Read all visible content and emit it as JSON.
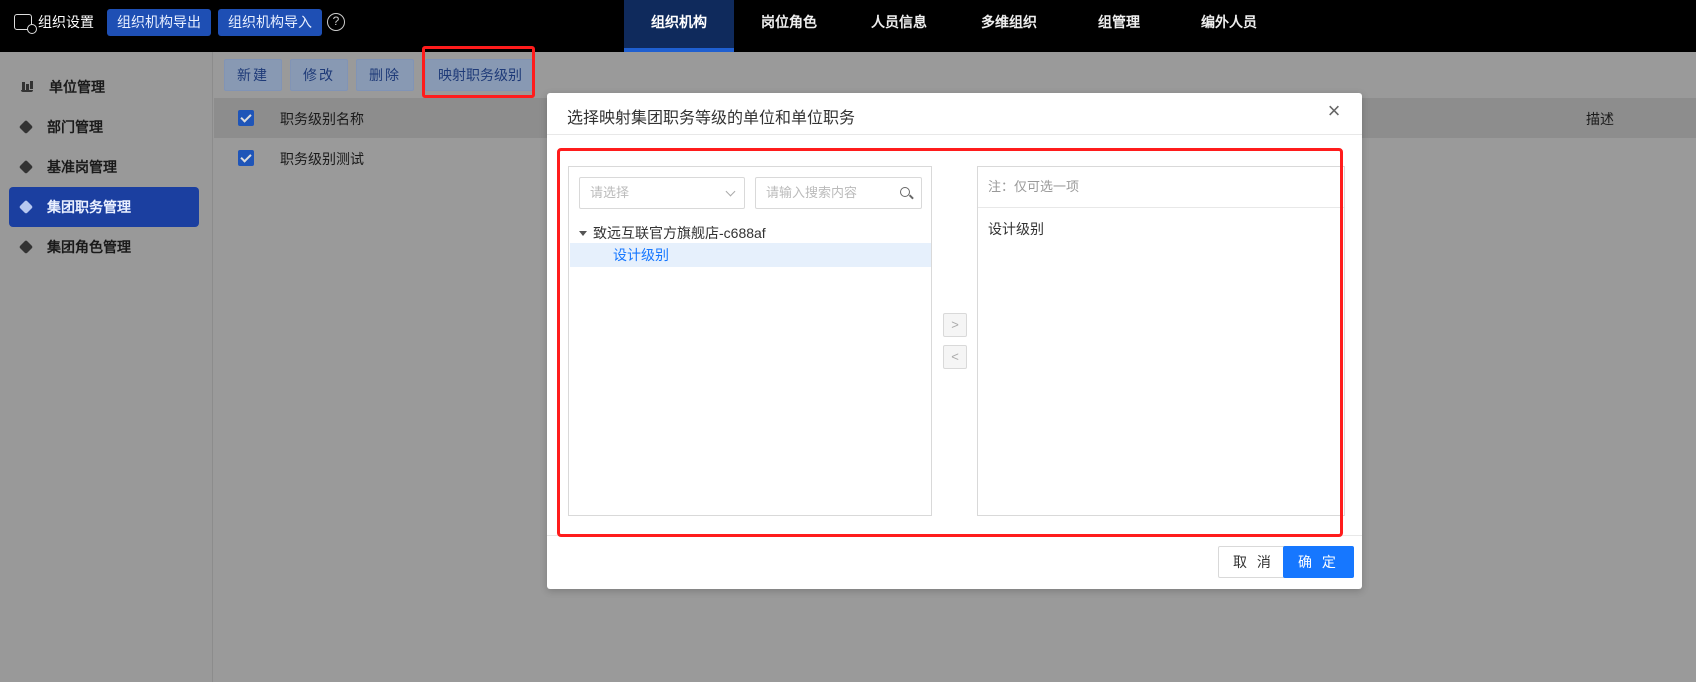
{
  "topbar": {
    "brand": "组织设置",
    "export_label": "组织机构导出",
    "import_label": "组织机构导入",
    "help_label": "?",
    "tabs": [
      {
        "label": "组织机构",
        "active": true
      },
      {
        "label": "岗位角色",
        "active": false
      },
      {
        "label": "人员信息",
        "active": false
      },
      {
        "label": "多维组织",
        "active": false
      },
      {
        "label": "组管理",
        "active": false
      },
      {
        "label": "编外人员",
        "active": false
      }
    ]
  },
  "sidebar": {
    "items": [
      {
        "label": "单位管理",
        "icon": "building-icon",
        "active": false
      },
      {
        "label": "部门管理",
        "icon": "cube-icon",
        "active": false
      },
      {
        "label": "基准岗管理",
        "icon": "cube-icon",
        "active": false
      },
      {
        "label": "集团职务管理",
        "icon": "cube-icon",
        "active": true
      },
      {
        "label": "集团角色管理",
        "icon": "cube-icon",
        "active": false
      }
    ]
  },
  "toolbar": {
    "new_label": "新建",
    "edit_label": "修改",
    "delete_label": "删除",
    "map_label": "映射职务级别"
  },
  "table": {
    "columns": [
      "职务级别名称",
      "描述"
    ],
    "rows": [
      {
        "name": "职务级别测试",
        "checked": true
      }
    ]
  },
  "modal": {
    "title": "选择映射集团职务等级的单位和单位职务",
    "close_label": "×",
    "select_placeholder": "请选择",
    "search_placeholder": "请输入搜索内容",
    "tree": {
      "root": "致远互联官方旗舰店-c688af",
      "child": "设计级别"
    },
    "move_right": ">",
    "move_left": "<",
    "note": "注：仅可选一项",
    "selected": [
      "设计级别"
    ],
    "cancel_label": "取 消",
    "ok_label": "确 定"
  },
  "colors": {
    "primary": "#1677ff",
    "highlight": "#ff1c1c",
    "sidebar_active": "#1b3fa0"
  }
}
